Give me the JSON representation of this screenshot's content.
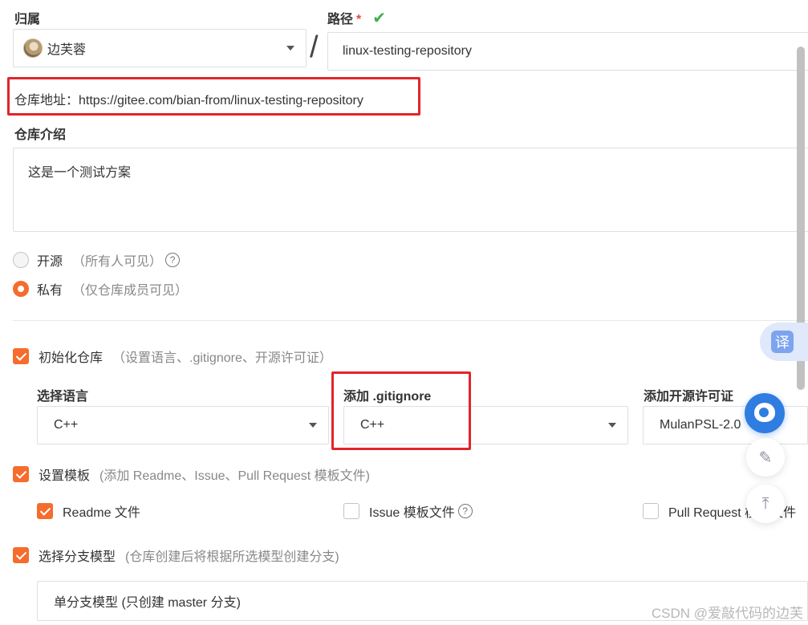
{
  "owner": {
    "label": "归属",
    "value": "边芙蓉"
  },
  "path": {
    "label": "路径",
    "required": "*",
    "value": "linux-testing-repository",
    "valid_icon": "check-icon"
  },
  "separator": "/",
  "repo_address": "仓库地址：https://gitee.com/bian-from/linux-testing-repository",
  "intro": {
    "label": "仓库介绍",
    "value": "这是一个测试方案"
  },
  "visibility": {
    "options": [
      {
        "label": "开源",
        "hint": "（所有人可见）",
        "selected": false
      },
      {
        "label": "私有",
        "hint": "（仅仓库成员可见）",
        "selected": true
      }
    ]
  },
  "init_repo": {
    "label": "初始化仓库",
    "hint": "（设置语言、.gitignore、开源许可证）",
    "checked": true
  },
  "language": {
    "label": "选择语言",
    "value": "C++"
  },
  "gitignore": {
    "label": "添加 .gitignore",
    "value": "C++"
  },
  "license": {
    "label": "添加开源许可证",
    "value": "MulanPSL-2.0"
  },
  "template": {
    "label": "设置模板",
    "hint": "(添加 Readme、Issue、Pull Request 模板文件)",
    "checked": true
  },
  "template_files": [
    {
      "label": "Readme 文件",
      "checked": true
    },
    {
      "label": "Issue 模板文件",
      "checked": false
    },
    {
      "label": "Pull Request 模板文件",
      "checked": false
    }
  ],
  "branch": {
    "label": "选择分支模型",
    "hint": "(仓库创建后将根据所选模型创建分支)",
    "checked": true,
    "value": "单分支模型 (只创建 master 分支)"
  },
  "floating": {
    "translate": "译"
  },
  "watermark": "CSDN @爱敲代码的边芙",
  "colors": {
    "accent": "#f56c2d",
    "highlight": "#e0262b",
    "valid": "#3fae49"
  }
}
